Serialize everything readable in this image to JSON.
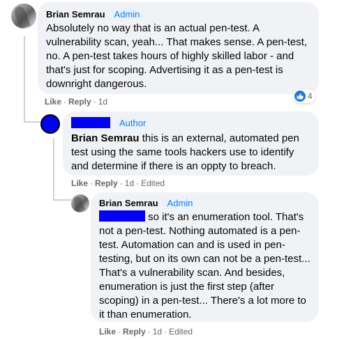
{
  "comments": [
    {
      "author": "Brian Semrau",
      "badge": "Admin",
      "text": "Absolutely no way that is an actual pen-test. A vulnerability scan, yeah... That makes sense. A pen-test, no. A pen-test takes hours of highly skilled labor - and that's just for scoping. Advertising it as a pen-test is downright dangerous.",
      "reaction_count": "4",
      "reaction_icon": "like-icon",
      "actions": {
        "like": "Like",
        "reply": "Reply",
        "time": "1d"
      }
    },
    {
      "badge": "Author",
      "mention": "Brian Semrau",
      "text": " this is an external, automated pen test using the same tools hackers use to identify and determine if there is an oppty to breach.",
      "actions": {
        "like": "Like",
        "reply": "Reply",
        "time": "1d",
        "edited": "Edited"
      }
    },
    {
      "author": "Brian Semrau",
      "badge": "Admin",
      "text_first_line": "so it's an enumeration tool. That's",
      "text": "not a pen-test. Nothing automated is a pen-test. Automation can and is used in pen-testing, but on its own can not be a pen-test... That's a vulnerability scan. And besides, enumeration is just the first step (after scoping) in a pen-test... There's a lot more to it than enumeration.",
      "actions": {
        "like": "Like",
        "reply": "Reply",
        "time": "1d",
        "edited": "Edited"
      }
    }
  ],
  "colors": {
    "bubble": "#f0f2f5",
    "badge_text": "#1877f2",
    "badge_bg": "#e7f3ff",
    "secondary_text": "#65676b",
    "thread_line": "#ced0d4",
    "redaction": "#0000ff"
  }
}
